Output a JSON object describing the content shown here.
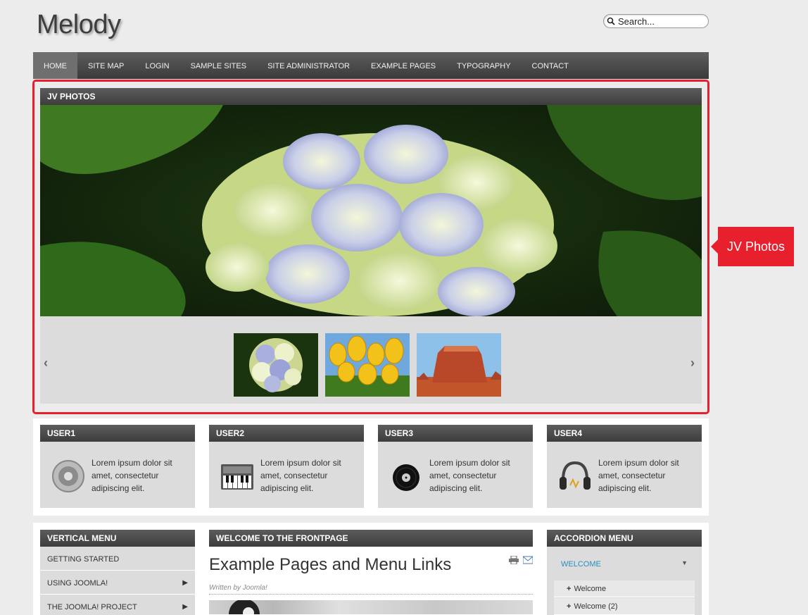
{
  "site": {
    "logo": "Melody"
  },
  "search": {
    "placeholder": "Search..."
  },
  "nav": [
    {
      "label": "HOME",
      "active": true
    },
    {
      "label": "SITE MAP"
    },
    {
      "label": "LOGIN"
    },
    {
      "label": "SAMPLE SITES"
    },
    {
      "label": "SITE ADMINISTRATOR"
    },
    {
      "label": "EXAMPLE PAGES"
    },
    {
      "label": "TYPOGRAPHY"
    },
    {
      "label": "CONTACT"
    }
  ],
  "photos": {
    "title": "JV PHOTOS",
    "thumbnails": [
      "hydrangea",
      "tulips",
      "desert-butte"
    ],
    "prev_icon": "‹",
    "next_icon": "›"
  },
  "callout": {
    "label": "JV Photos",
    "color": "#e8202e"
  },
  "users": [
    {
      "title": "USER1",
      "text": "Lorem ipsum dolor sit amet, consectetur adipiscing elit.",
      "icon": "speaker-icon"
    },
    {
      "title": "USER2",
      "text": "Lorem ipsum dolor sit amet, consectetur adipiscing elit.",
      "icon": "keyboard-icon"
    },
    {
      "title": "USER3",
      "text": "Lorem ipsum dolor sit amet, consectetur adipiscing elit.",
      "icon": "vinyl-record-icon"
    },
    {
      "title": "USER4",
      "text": "Lorem ipsum dolor sit amet, consectetur adipiscing elit.",
      "icon": "headphones-icon"
    }
  ],
  "vertical_menu": {
    "title": "VERTICAL MENU",
    "items": [
      {
        "label": "GETTING STARTED",
        "has_children": false
      },
      {
        "label": "USING JOOMLA!",
        "has_children": true
      },
      {
        "label": "THE JOOMLA! PROJECT",
        "has_children": true
      }
    ]
  },
  "frontpage": {
    "title": "WELCOME TO THE FRONTPAGE",
    "heading": "Example Pages and Menu Links",
    "byline": "Written by Joomla!"
  },
  "accordion": {
    "title": "ACCORDION MENU",
    "open_item": "WELCOME",
    "sub_items": [
      "Welcome",
      "Welcome (2)"
    ],
    "link_color": "#2a8fc0"
  }
}
